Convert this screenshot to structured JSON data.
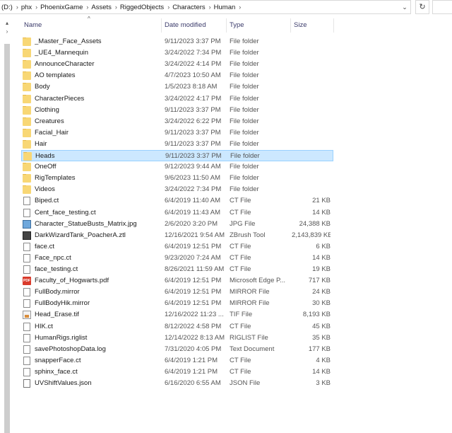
{
  "breadcrumbs": [
    "(D:)",
    "phx",
    "PhoenixGame",
    "Assets",
    "RiggedObjects",
    "Characters",
    "Human"
  ],
  "columns": {
    "name": "Name",
    "date": "Date modified",
    "type": "Type",
    "size": "Size"
  },
  "files": [
    {
      "name": "_Master_Face_Assets",
      "date": "9/11/2023 3:37 PM",
      "type": "File folder",
      "size": "",
      "icon": "folder-icon"
    },
    {
      "name": "_UE4_Mannequin",
      "date": "3/24/2022 7:34 PM",
      "type": "File folder",
      "size": "",
      "icon": "folder-icon"
    },
    {
      "name": "AnnounceCharacter",
      "date": "3/24/2022 4:14 PM",
      "type": "File folder",
      "size": "",
      "icon": "folder-icon"
    },
    {
      "name": "AO templates",
      "date": "4/7/2023 10:50 AM",
      "type": "File folder",
      "size": "",
      "icon": "folder-icon"
    },
    {
      "name": "Body",
      "date": "1/5/2023 8:18 AM",
      "type": "File folder",
      "size": "",
      "icon": "folder-icon"
    },
    {
      "name": "CharacterPieces",
      "date": "3/24/2022 4:17 PM",
      "type": "File folder",
      "size": "",
      "icon": "folder-icon"
    },
    {
      "name": "Clothing",
      "date": "9/11/2023 3:37 PM",
      "type": "File folder",
      "size": "",
      "icon": "folder-icon"
    },
    {
      "name": "Creatures",
      "date": "3/24/2022 6:22 PM",
      "type": "File folder",
      "size": "",
      "icon": "folder-icon"
    },
    {
      "name": "Facial_Hair",
      "date": "9/11/2023 3:37 PM",
      "type": "File folder",
      "size": "",
      "icon": "folder-icon"
    },
    {
      "name": "Hair",
      "date": "9/11/2023 3:37 PM",
      "type": "File folder",
      "size": "",
      "icon": "folder-icon"
    },
    {
      "name": "Heads",
      "date": "9/11/2023 3:37 PM",
      "type": "File folder",
      "size": "",
      "icon": "folder-icon",
      "selected": true
    },
    {
      "name": "OneOff",
      "date": "9/12/2023 9:44 AM",
      "type": "File folder",
      "size": "",
      "icon": "folder-icon"
    },
    {
      "name": "RigTemplates",
      "date": "9/6/2023 11:50 AM",
      "type": "File folder",
      "size": "",
      "icon": "folder-icon"
    },
    {
      "name": "Videos",
      "date": "3/24/2022 7:34 PM",
      "type": "File folder",
      "size": "",
      "icon": "folder-icon"
    },
    {
      "name": "Biped.ct",
      "date": "6/4/2019 11:40 AM",
      "type": "CT File",
      "size": "21 KB",
      "icon": "file-icon"
    },
    {
      "name": "Cent_face_testing.ct",
      "date": "6/4/2019 11:43 AM",
      "type": "CT File",
      "size": "14 KB",
      "icon": "file-icon"
    },
    {
      "name": "Character_StatueBusts_Matrix.jpg",
      "date": "2/6/2020 3:20 PM",
      "type": "JPG File",
      "size": "24,388 KB",
      "icon": "image-icon"
    },
    {
      "name": "DarkWizardTank_PoacherA.ztl",
      "date": "12/16/2021 9:54 AM",
      "type": "ZBrush Tool",
      "size": "2,143,839 KB",
      "icon": "zbrush-icon"
    },
    {
      "name": "face.ct",
      "date": "6/4/2019 12:51 PM",
      "type": "CT File",
      "size": "6 KB",
      "icon": "file-icon"
    },
    {
      "name": "Face_npc.ct",
      "date": "9/23/2020 7:24 AM",
      "type": "CT File",
      "size": "14 KB",
      "icon": "file-icon"
    },
    {
      "name": "face_testing.ct",
      "date": "8/26/2021 11:59 AM",
      "type": "CT File",
      "size": "19 KB",
      "icon": "file-icon"
    },
    {
      "name": "Faculty_of_Hogwarts.pdf",
      "date": "6/4/2019 12:51 PM",
      "type": "Microsoft Edge P...",
      "size": "717 KB",
      "icon": "pdf-icon"
    },
    {
      "name": "FullBody.mirror",
      "date": "6/4/2019 12:51 PM",
      "type": "MIRROR File",
      "size": "24 KB",
      "icon": "file-icon"
    },
    {
      "name": "FullBodyHik.mirror",
      "date": "6/4/2019 12:51 PM",
      "type": "MIRROR File",
      "size": "30 KB",
      "icon": "file-icon"
    },
    {
      "name": "Head_Erase.tif",
      "date": "12/16/2022 11:23 ...",
      "type": "TIF File",
      "size": "8,193 KB",
      "icon": "tif-icon"
    },
    {
      "name": "HIK.ct",
      "date": "8/12/2022 4:58 PM",
      "type": "CT File",
      "size": "45 KB",
      "icon": "file-icon"
    },
    {
      "name": "HumanRigs.riglist",
      "date": "12/14/2022 8:13 AM",
      "type": "RIGLIST File",
      "size": "35 KB",
      "icon": "file-icon"
    },
    {
      "name": "savePhotoshopData.log",
      "date": "7/31/2020 4:05 PM",
      "type": "Text Document",
      "size": "177 KB",
      "icon": "file-icon"
    },
    {
      "name": "snapperFace.ct",
      "date": "6/4/2019 1:21 PM",
      "type": "CT File",
      "size": "4 KB",
      "icon": "file-icon"
    },
    {
      "name": "sphinx_face.ct",
      "date": "6/4/2019 1:21 PM",
      "type": "CT File",
      "size": "14 KB",
      "icon": "file-icon"
    },
    {
      "name": "UVShiftValues.json",
      "date": "6/16/2020 6:55 AM",
      "type": "JSON File",
      "size": "3 KB",
      "icon": "json-icon"
    }
  ]
}
